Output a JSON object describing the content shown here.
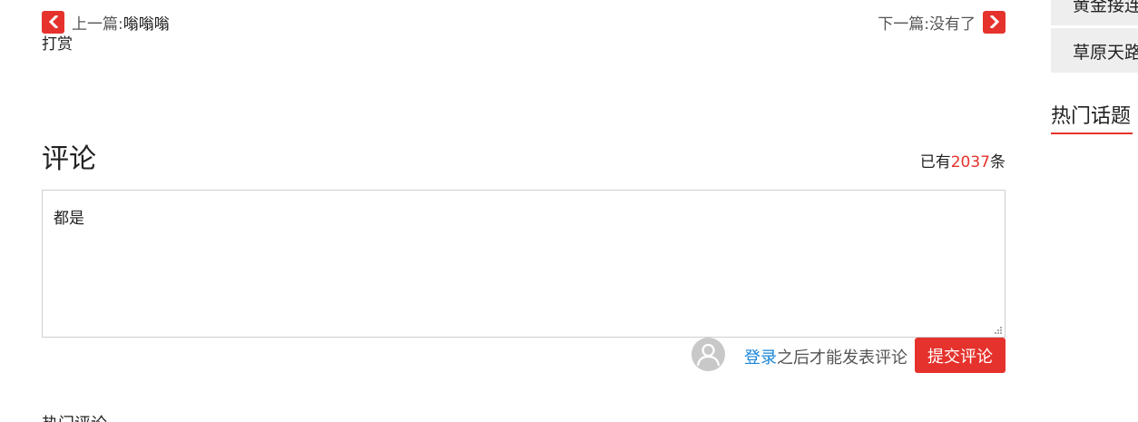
{
  "nav": {
    "prev_label": "上一篇:",
    "prev_title": "嗡嗡嗡",
    "next_label": "下一篇:",
    "next_title": "没有了"
  },
  "reward_label": "打赏",
  "comments": {
    "title": "评论",
    "count_prefix": "已有",
    "count": "2037",
    "count_suffix": "条",
    "input_value": "都是",
    "login_link": "登录",
    "login_hint": "之后才能发表评论",
    "submit_label": "提交评论",
    "hot_title": "热门评论"
  },
  "sidebar": {
    "items": [
      {
        "label": "黄金接连"
      },
      {
        "label": "草原天路"
      }
    ],
    "hot_topics_title": "热门话题"
  },
  "colors": {
    "accent": "#e5322d",
    "link": "#1a86d8"
  }
}
